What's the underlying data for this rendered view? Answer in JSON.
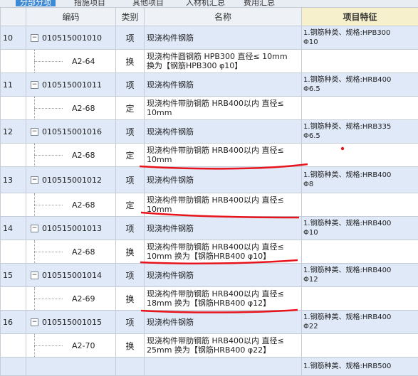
{
  "tabs": [
    "分部分项",
    "措施项目",
    "其他项目",
    "人材机汇总",
    "费用汇总"
  ],
  "columns": {
    "code": "编码",
    "type": "类别",
    "name": "名称",
    "feature": "项目特征"
  },
  "rows": [
    {
      "kind": "main",
      "index": "10",
      "toggle": "−",
      "code": "010515001010",
      "type": "项",
      "name": [
        "现浇构件钢筋"
      ],
      "feature": [
        "1.钢筋种类、规格:HPB300",
        "Φ10"
      ]
    },
    {
      "kind": "sub",
      "code": "A2-64",
      "type": "换",
      "name": [
        "现浇构件圆钢筋 HPB300 直径≤ 10mm",
        "换为【钢筋HPB300 φ10】"
      ],
      "feature": []
    },
    {
      "kind": "main",
      "index": "11",
      "toggle": "−",
      "code": "010515001011",
      "type": "项",
      "name": [
        "现浇构件钢筋"
      ],
      "feature": [
        "1.钢筋种类、规格:HRB400",
        "Φ6.5"
      ]
    },
    {
      "kind": "sub",
      "code": "A2-68",
      "type": "定",
      "name": [
        "现浇构件带肋钢筋 HRB400以内 直径≤",
        "10mm"
      ],
      "feature": []
    },
    {
      "kind": "main",
      "index": "12",
      "toggle": "−",
      "code": "010515001016",
      "type": "项",
      "name": [
        "现浇构件钢筋"
      ],
      "feature": [
        "1.钢筋种类、规格:HRB335",
        "Φ6.5"
      ]
    },
    {
      "kind": "sub",
      "code": "A2-68",
      "type": "定",
      "name": [
        "现浇构件带肋钢筋 HRB400以内 直径≤",
        "10mm"
      ],
      "feature": []
    },
    {
      "kind": "main",
      "index": "13",
      "toggle": "−",
      "code": "010515001012",
      "type": "项",
      "name": [
        "现浇构件钢筋"
      ],
      "feature": [
        "1.钢筋种类、规格:HRB400",
        "Φ8"
      ]
    },
    {
      "kind": "sub",
      "code": "A2-68",
      "type": "定",
      "name": [
        "现浇构件带肋钢筋 HRB400以内 直径≤",
        "10mm"
      ],
      "feature": []
    },
    {
      "kind": "main",
      "index": "14",
      "toggle": "−",
      "code": "010515001013",
      "type": "项",
      "name": [
        "现浇构件钢筋"
      ],
      "feature": [
        "1.钢筋种类、规格:HRB400",
        "Φ10"
      ]
    },
    {
      "kind": "sub",
      "code": "A2-68",
      "type": "换",
      "name": [
        "现浇构件带肋钢筋 HRB400以内 直径≤",
        "10mm 换为【钢筋HRB400 φ10】"
      ],
      "feature": []
    },
    {
      "kind": "main",
      "index": "15",
      "toggle": "−",
      "code": "010515001014",
      "type": "项",
      "name": [
        "现浇构件钢筋"
      ],
      "feature": [
        "1.钢筋种类、规格:HRB400",
        "Φ12"
      ]
    },
    {
      "kind": "sub",
      "code": "A2-69",
      "type": "换",
      "name": [
        "现浇构件带肋钢筋 HRB400以内 直径≤",
        "18mm 换为【钢筋HRB400 φ12】"
      ],
      "feature": []
    },
    {
      "kind": "main",
      "index": "16",
      "toggle": "−",
      "code": "010515001015",
      "type": "项",
      "name": [
        "现浇构件钢筋"
      ],
      "feature": [
        "1.钢筋种类、规格:HRB400",
        "Φ22"
      ]
    },
    {
      "kind": "sub",
      "code": "A2-70",
      "type": "换",
      "name": [
        "现浇构件带肋钢筋 HRB400以内 直径≤",
        "25mm 换为【钢筋HRB400 φ22】"
      ],
      "feature": []
    },
    {
      "kind": "main",
      "index": "",
      "toggle": "",
      "code": "",
      "type": "",
      "name": [],
      "feature": [
        "1.钢筋种类、规格:HRB500"
      ]
    }
  ],
  "annotation_color": "#e8141c"
}
